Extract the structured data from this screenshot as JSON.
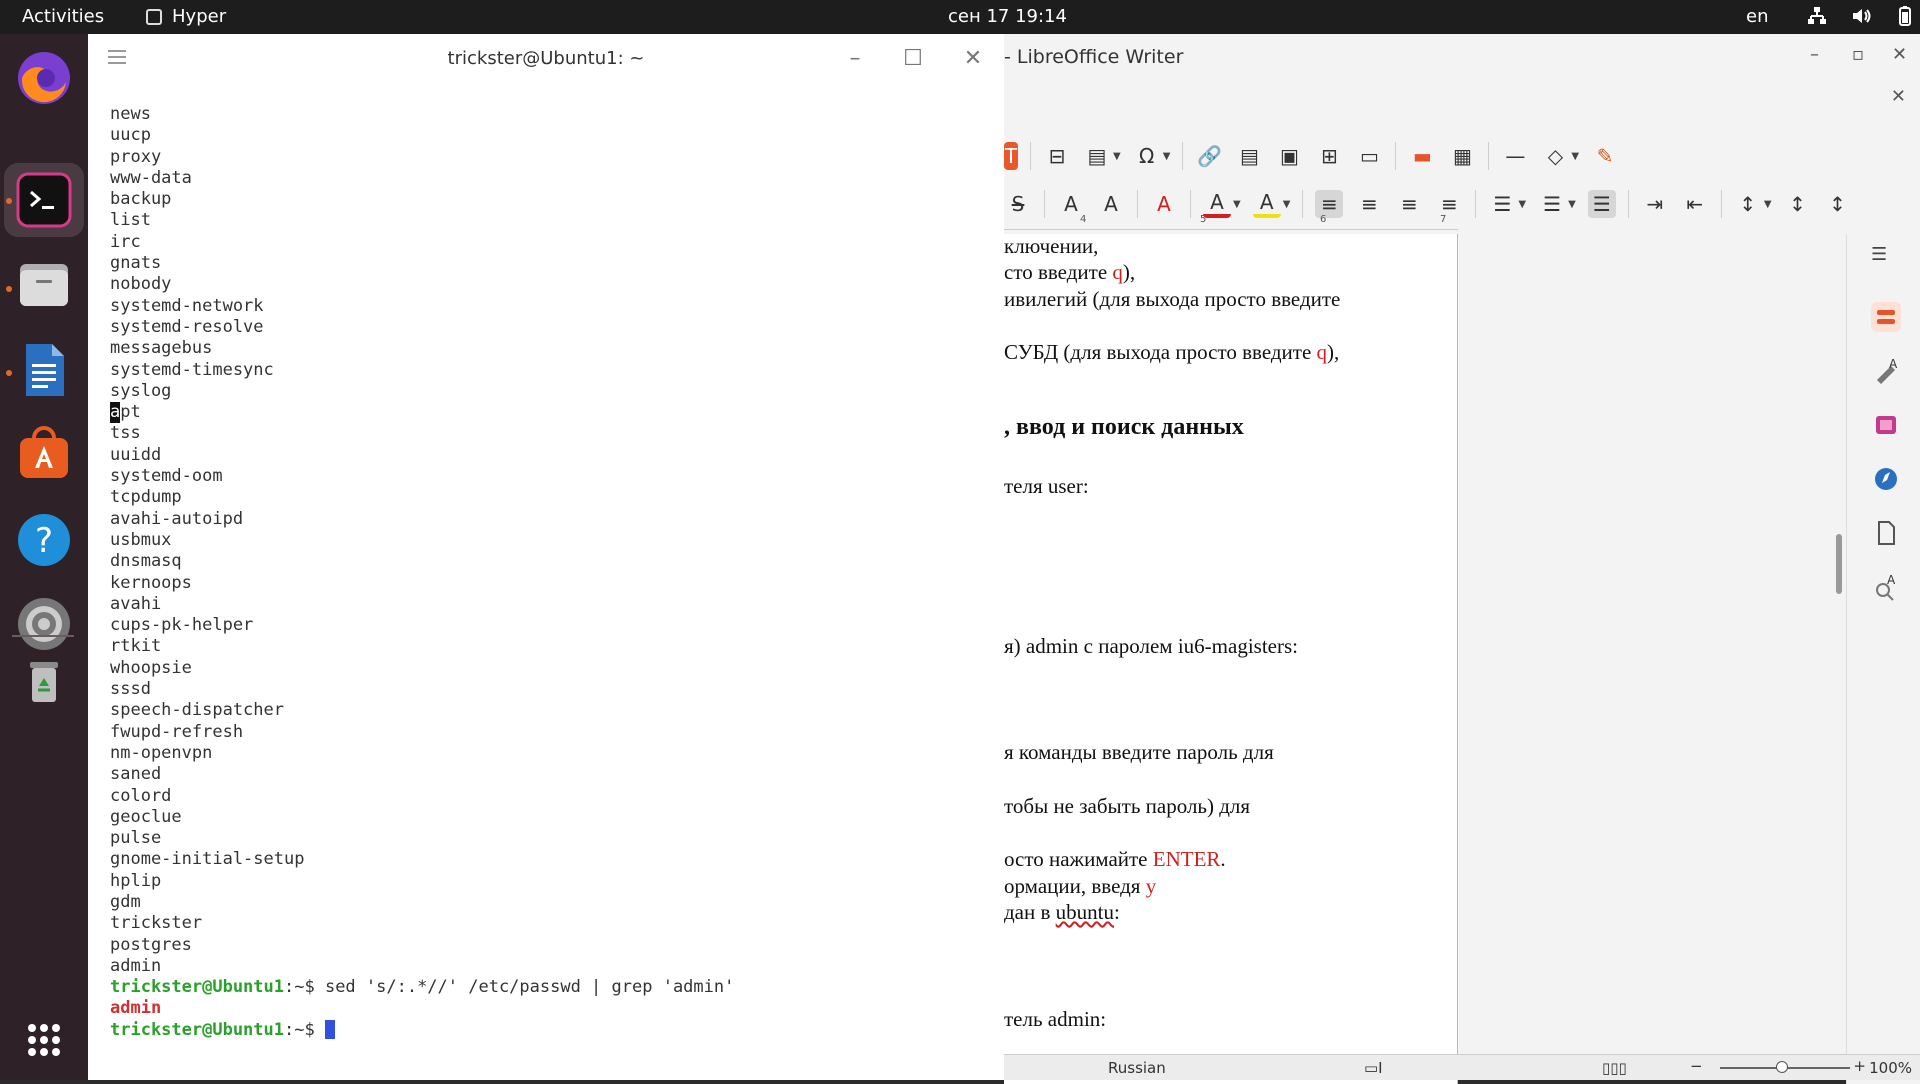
{
  "topbar": {
    "activities": "Activities",
    "app_name": "Hyper",
    "clock": "сен 17  19:14",
    "lang": "en"
  },
  "terminal": {
    "title": "trickster@Ubuntu1: ~",
    "lines": [
      "news",
      "uucp",
      "proxy",
      "www-data",
      "backup",
      "list",
      "irc",
      "gnats",
      "nobody",
      "systemd-network",
      "systemd-resolve",
      "messagebus",
      "systemd-timesync",
      "syslog"
    ],
    "apt_first": "a",
    "apt_rest": "pt",
    "lines2": [
      "tss",
      "uuidd",
      "systemd-oom",
      "tcpdump",
      "avahi-autoipd",
      "usbmux",
      "dnsmasq",
      "kernoops",
      "avahi",
      "cups-pk-helper",
      "rtkit",
      "whoopsie",
      "sssd",
      "speech-dispatcher",
      "fwupd-refresh",
      "nm-openvpn",
      "saned",
      "colord",
      "geoclue",
      "pulse",
      "gnome-initial-setup",
      "hplip",
      "gdm",
      "trickster",
      "postgres",
      "admin"
    ],
    "prompt": "trickster@Ubuntu1",
    "prompt_sep": ":~$ ",
    "command": "sed 's/:.*//' /etc/passwd | grep 'admin'",
    "output": "admin"
  },
  "writer": {
    "title": "- LibreOffice Writer",
    "ruler": [
      "4",
      "5",
      "6",
      "7"
    ],
    "page": {
      "l1": "ключении,",
      "l2a": "сто введите ",
      "l2b": "q",
      "l2c": "),",
      "l3": "ивилегий (для выхода просто введите",
      "l4a": "СУБД (для выхода просто введите ",
      "l4b": "q",
      "l4c": "),",
      "heading": ", ввод и поиск данных",
      "l5": "теля user:",
      "l6": "я) admin с паролем iu6-magisters:",
      "l7": "я команды введите пароль для",
      "l8": "тобы не забыть пароль) для",
      "l9a": "осто нажимайте ",
      "l9b": "ENTER",
      "l9c": ".",
      "l10a": "ормации, введя ",
      "l10b": "y",
      "l11a": "дан в ",
      "l11b": "ubuntu",
      "l11c": ":",
      "l12": "тель admin:"
    },
    "status": {
      "language": "Russian",
      "zoom": "100%"
    }
  }
}
